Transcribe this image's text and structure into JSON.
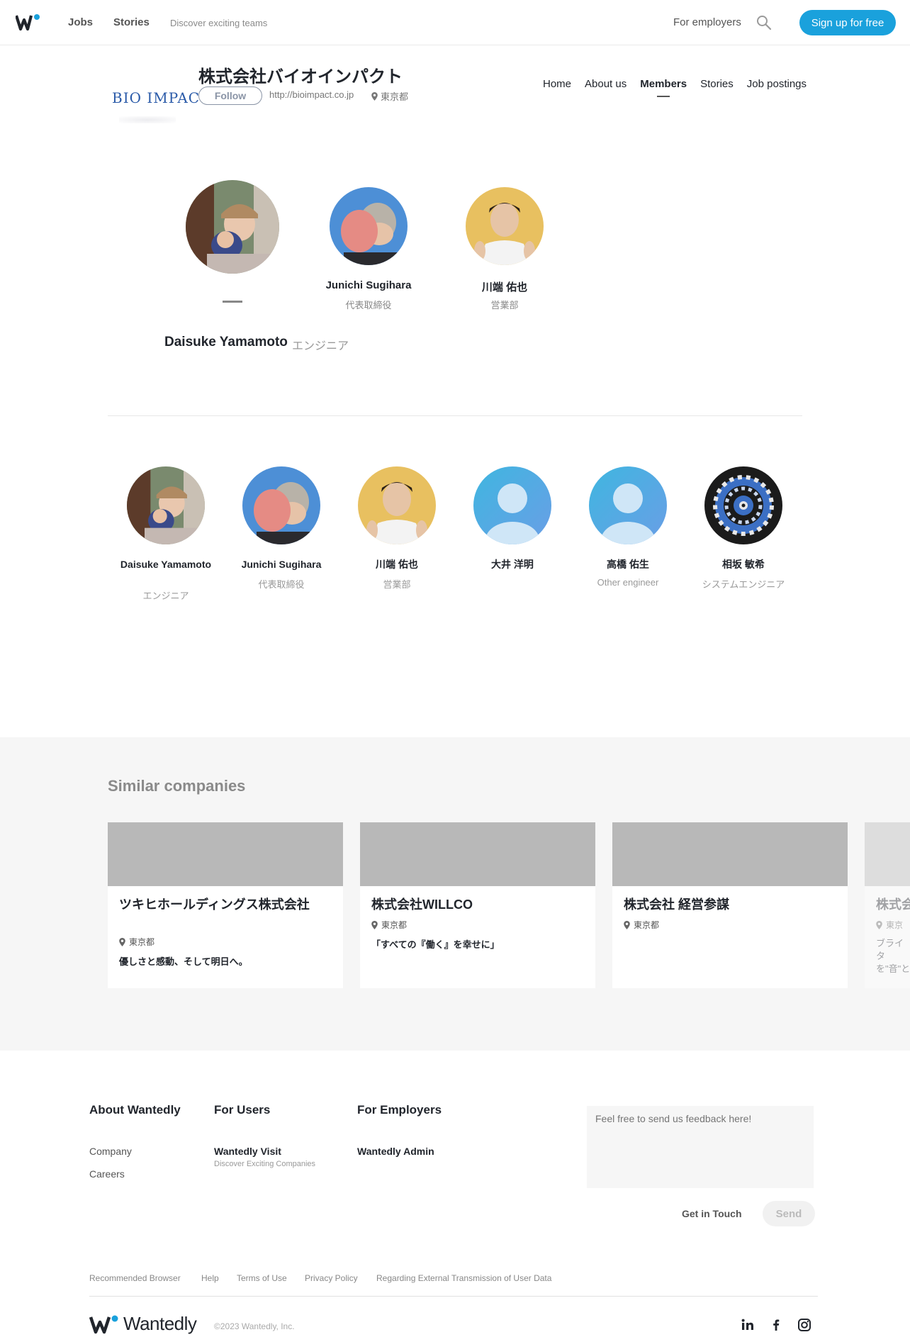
{
  "nav": {
    "jobs": "Jobs",
    "stories": "Stories",
    "discover": "Discover exciting teams",
    "for_employers": "For employers",
    "signup": "Sign up for free"
  },
  "company": {
    "logo_text": "BIO IMPACT",
    "name": "株式会社バイオインパクト",
    "follow": "Follow",
    "url": "http://bioimpact.co.jp",
    "location": "東京都"
  },
  "tabs": [
    {
      "label": "Home"
    },
    {
      "label": "About us"
    },
    {
      "label": "Members",
      "active": true
    },
    {
      "label": "Stories"
    },
    {
      "label": "Job postings"
    }
  ],
  "featured": [
    {
      "name": "",
      "role": "",
      "selected": true
    },
    {
      "name": "Junichi Sugihara",
      "role": "代表取締役"
    },
    {
      "name": "川端 佑也",
      "role": "営業部"
    }
  ],
  "selected_member": {
    "name": "Daisuke Yamamoto",
    "role": "エンジニア"
  },
  "members": [
    {
      "name": "Daisuke Yamamoto",
      "role": "エンジニア",
      "avatar": "photo-1"
    },
    {
      "name": "Junichi Sugihara",
      "role": "代表取締役",
      "avatar": "photo-2"
    },
    {
      "name": "川端 佑也",
      "role": "営業部",
      "avatar": "photo-3"
    },
    {
      "name": "大井 洋明",
      "role": "",
      "avatar": "default"
    },
    {
      "name": "高橋 佑生",
      "role": "Other engineer",
      "avatar": "default"
    },
    {
      "name": "相坂 敏希",
      "role": "システムエンジニア",
      "avatar": "dartboard"
    }
  ],
  "similar": {
    "title": "Similar companies",
    "cards": [
      {
        "name": "ツキヒホールディングス株式会社",
        "location": "東京都",
        "desc": "優しさと感動、そして明日へ。"
      },
      {
        "name": "株式会社WILLCO",
        "location": "東京都",
        "desc": "「すべての『働く』を幸せに」"
      },
      {
        "name": "株式会社 経営参謀",
        "location": "東京都",
        "desc": ""
      },
      {
        "name": "株式会",
        "location": "東京",
        "desc": "ブライタ を\"音\"と"
      }
    ]
  },
  "footer": {
    "about": {
      "title": "About Wantedly",
      "links": [
        "Company",
        "Careers"
      ]
    },
    "users": {
      "title": "For Users",
      "link": "Wantedly Visit",
      "sub": "Discover Exciting Companies"
    },
    "employers": {
      "title": "For Employers",
      "link": "Wantedly Admin"
    },
    "feedback_placeholder": "Feel free to send us feedback here!",
    "get_in_touch": "Get in Touch",
    "send": "Send",
    "legal": [
      "Recommended Browser",
      "Help",
      "Terms of Use",
      "Privacy Policy",
      "Regarding External Transmission of User Data"
    ],
    "brand": "Wantedly",
    "copyright": "©2023 Wantedly, Inc."
  },
  "colors": {
    "accent": "#1aa1dc",
    "text": "#21252c",
    "logo": "#2a5aa8"
  }
}
